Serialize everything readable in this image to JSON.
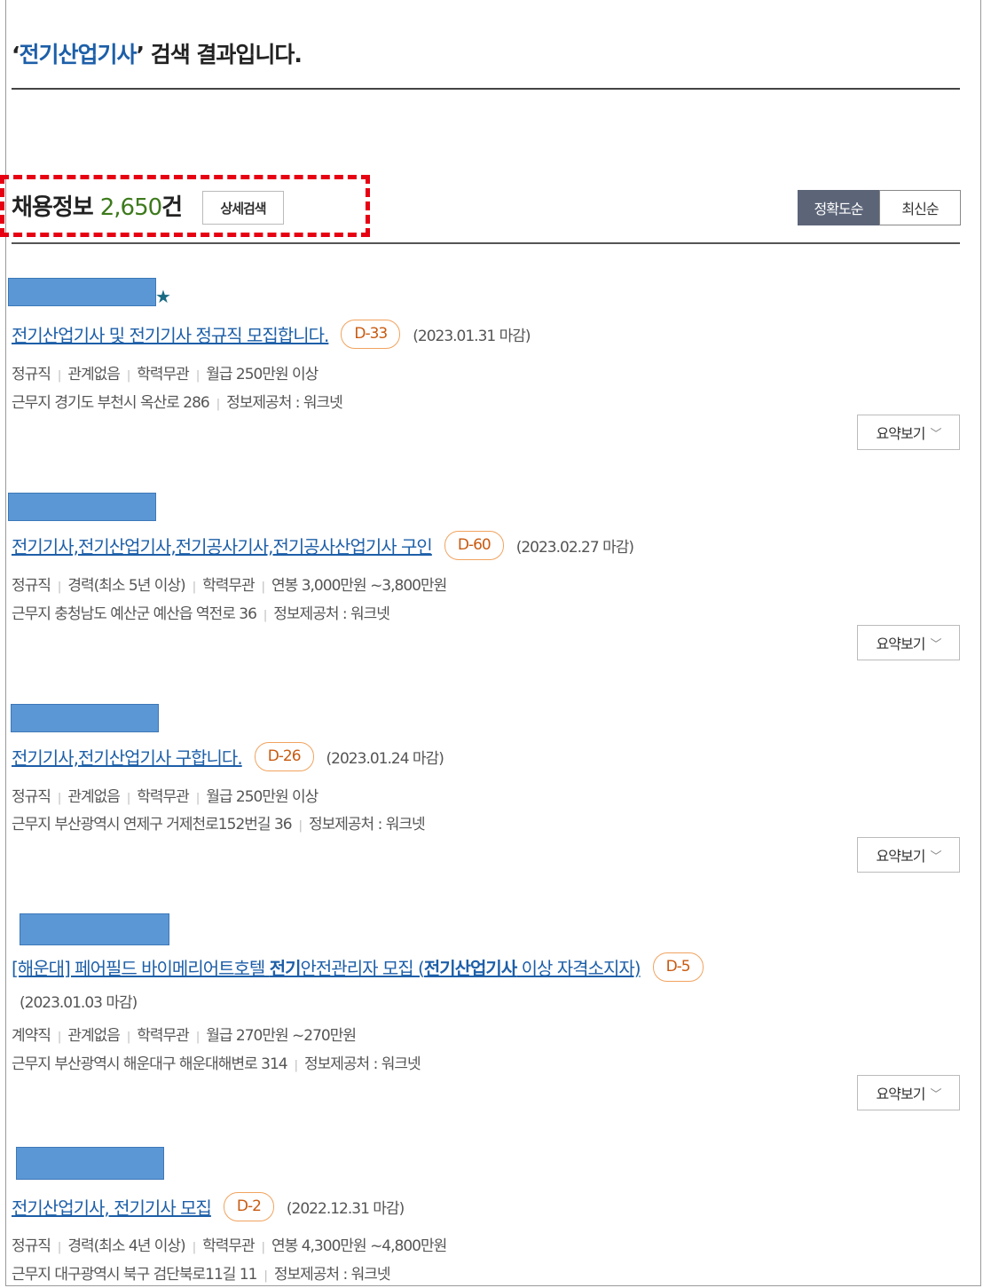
{
  "header": {
    "title_quote_open": "‘",
    "keyword": "전기산업기사",
    "title_suffix": "’ 검색 결과입니다."
  },
  "results": {
    "label": "채용정보 ",
    "count": "2,650",
    "unit": "건",
    "detail_search_label": "상세검색",
    "sort": {
      "accuracy_label": "정확도순",
      "latest_label": "최신순",
      "active": "accuracy"
    }
  },
  "summary_label": "요약보기",
  "jobs": [
    {
      "title": "전기산업기사 및 전기기사 정규직 모집합니다.",
      "dday": "D-33",
      "deadline": "(2023.01.31 마감)",
      "employment": "정규직",
      "experience": "관계없음",
      "education": "학력무관",
      "salary": "월급 250만원 이상",
      "location": "근무지 경기도 부천시 옥산로 286",
      "source": "정보제공처 : 워크넷"
    },
    {
      "title": "전기기사,전기산업기사,전기공사기사,전기공사산업기사 구인",
      "dday": "D-60",
      "deadline": "(2023.02.27 마감)",
      "employment": "정규직",
      "experience": "경력(최소 5년 이상)",
      "education": "학력무관",
      "salary": "연봉 3,000만원 ~3,800만원",
      "location": "근무지 충청남도 예산군 예산읍 역전로 36",
      "source": "정보제공처 : 워크넷"
    },
    {
      "title": "전기기사,전기산업기사 구합니다.",
      "dday": "D-26",
      "deadline": "(2023.01.24 마감)",
      "employment": "정규직",
      "experience": "관계없음",
      "education": "학력무관",
      "salary": "월급 250만원 이상",
      "location": "근무지 부산광역시 연제구 거제천로152번길 36",
      "source": "정보제공처 : 워크넷"
    },
    {
      "title_part1": "[해운대] 페어필드 바이메리어트호텔 ",
      "title_bold1": "전기",
      "title_part2": "안전관리자 모집 (",
      "title_bold2": "전기산업기사",
      "title_part3": " 이상 자격소지자)",
      "dday": "D-5",
      "deadline": "(2023.01.03 마감)",
      "employment": "계약직",
      "experience": "관계없음",
      "education": "학력무관",
      "salary": "월급 270만원 ~270만원",
      "location": "근무지 부산광역시 해운대구 해운대해변로 314",
      "source": "정보제공처 : 워크넷"
    },
    {
      "title": "전기산업기사, 전기기사 모집",
      "dday": "D-2",
      "deadline": "(2022.12.31 마감)",
      "employment": "정규직",
      "experience": "경력(최소 4년 이상)",
      "education": "학력무관",
      "salary": "연봉 4,300만원 ~4,800만원",
      "location": "근무지 대구광역시 북구 검단북로11길 11",
      "source": "정보제공처 : 워크넷"
    }
  ],
  "icons": {
    "star": "star-icon",
    "chevron": "chevron-down-icon"
  },
  "colors": {
    "keyword": "#1d5fa8",
    "count": "#3d7a1c",
    "sort_active": "#5c6578",
    "highlight": "#e60012",
    "dday_border": "#f1a35f",
    "redaction": "#5b97d5"
  }
}
